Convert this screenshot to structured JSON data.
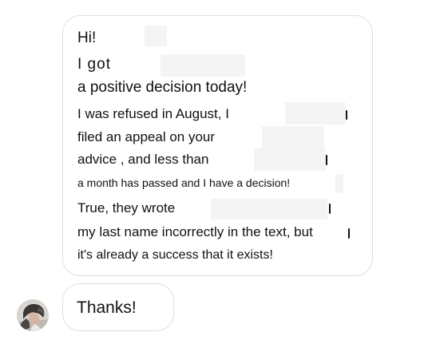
{
  "conversation": {
    "main_message": {
      "lines": [
        "Hi!",
        "I got",
        "a positive decision today!",
        "I was refused in August, I",
        "filed an appeal on your",
        "advice , and less than",
        "a month has passed and I have a decision!",
        "True, they wrote",
        "my last name incorrectly in the text, but",
        "it's already a success that it exists!"
      ]
    },
    "reply_message": {
      "text": "Thanks!"
    },
    "avatar": {
      "icon": "profile-photo"
    }
  },
  "colors": {
    "background": "#ffffff",
    "bubble_border": "#dedede",
    "text": "#111111",
    "redaction": "#f4f4f4"
  }
}
